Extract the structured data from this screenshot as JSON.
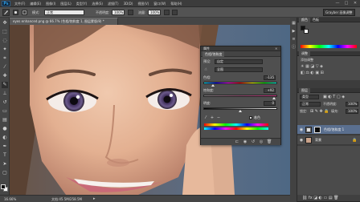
{
  "app": {
    "logo": "Ps"
  },
  "menu": [
    "文件(F)",
    "编辑(E)",
    "图像(I)",
    "图层(L)",
    "类型(Y)",
    "选择(S)",
    "滤镜(T)",
    "3D(D)",
    "视图(V)",
    "窗口(W)",
    "帮助(H)"
  ],
  "window_controls": [
    "—",
    "□",
    "✕"
  ],
  "options": {
    "mode_label": "模式:",
    "mode_value": "正常",
    "opacity_label": "不透明度:",
    "opacity_value": "100%",
    "flow_label": "流量:",
    "flow_value": "100%",
    "workspace": "Grayber 画像调整"
  },
  "document": {
    "tab_title": "eyes enhanced.png @ 66.7% (色相/饱和度 1, 图层蒙版/8) *",
    "zoom": "16.66%",
    "info": "文档:45.5M/258.5M"
  },
  "colors": {
    "fg": "#111111",
    "bg": "#ffffff",
    "accent": "#5a6f8f"
  },
  "hue_sat": {
    "panel_title": "属性",
    "tab": "色相/饱和度",
    "preset_label": "预设:",
    "preset_value": "自定",
    "channel_value": "全图",
    "hue_label": "色相:",
    "hue_value": "-135",
    "saturation_label": "饱和度:",
    "saturation_value": "+92",
    "lightness_label": "明度:",
    "lightness_value": "0",
    "colorize_label": "着色",
    "hue_level": 0.125,
    "saturation_level": 0.96,
    "lightness_level": 0.5
  },
  "right_panels": {
    "color_tab": "颜色",
    "swatches_tab": "色板",
    "adjust_tab": "调整",
    "adjust_label": "添加调整",
    "layers_tab": "图层",
    "kind_label": "类型",
    "blend_value": "正常",
    "opacity_label": "不透明度:",
    "opacity_value": "100%",
    "lock_label": "锁定:",
    "fill_label": "填充:",
    "fill_value": "100%"
  },
  "layers": [
    {
      "name": "色相/饱和度 1",
      "active": true
    },
    {
      "name": "背景",
      "active": false
    }
  ]
}
